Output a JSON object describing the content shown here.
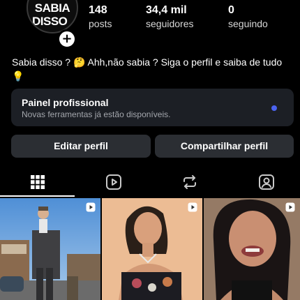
{
  "profile": {
    "avatar_text_line1": "SABIA",
    "avatar_text_line2": "DISSO",
    "avatar_symbol": "?",
    "add_symbol": "+"
  },
  "stats": [
    {
      "value": "148",
      "label": "posts"
    },
    {
      "value": "34,4 mil",
      "label": "seguidores"
    },
    {
      "value": "0",
      "label": "seguindo"
    }
  ],
  "bio": {
    "text_part1": "Sabia disso ? ",
    "emoji1": "🤔",
    "text_part2": " Ahh,não sabia ? Siga o perfil e saiba de tudo",
    "emoji2": "💡"
  },
  "professional_panel": {
    "title": "Painel profissional",
    "subtitle": "Novas ferramentas já estão disponíveis.",
    "indicator_color": "#4b63f0"
  },
  "actions": {
    "edit_label": "Editar perfil",
    "share_label": "Compartilhar perfil"
  },
  "tabs": [
    "grid-icon",
    "reels-icon",
    "reposts-icon",
    "tagged-icon"
  ],
  "grid": [
    {
      "type": "reel",
      "description_icon": "reel-play-icon"
    },
    {
      "type": "reel",
      "description_icon": "reel-play-icon"
    },
    {
      "type": "reel",
      "description_icon": "reel-play-icon"
    }
  ]
}
